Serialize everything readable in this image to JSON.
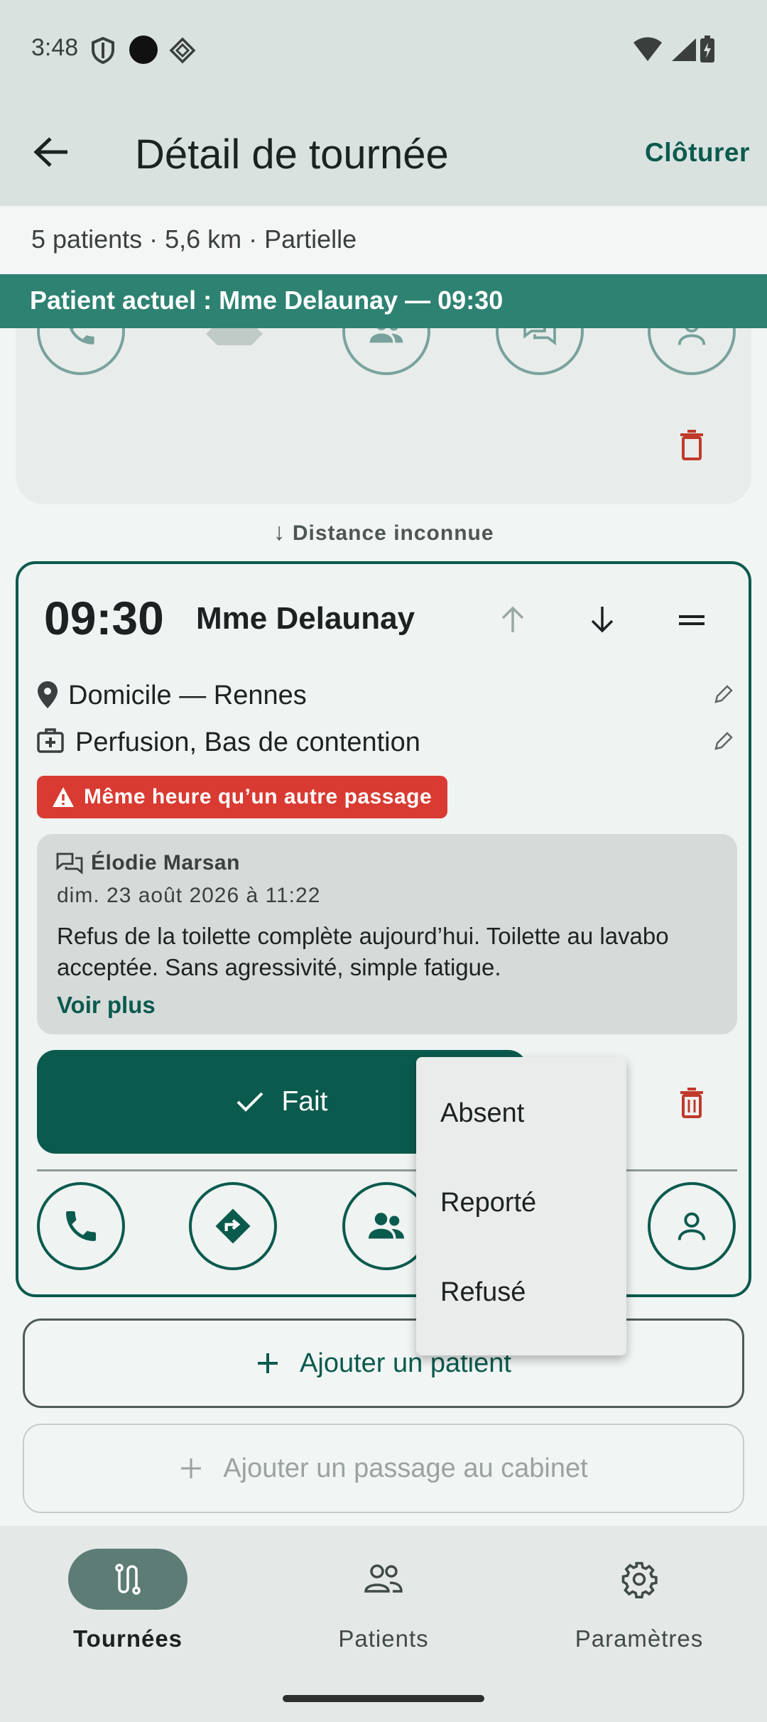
{
  "status_bar": {
    "time": "3:48"
  },
  "app_bar": {
    "title": "Détail de tournée",
    "action_label": "Clôturer"
  },
  "summary": {
    "text": "5 patients · 5,6 km · Partielle"
  },
  "current_patient": {
    "text": "Patient actuel : Mme Delaunay — 09:30"
  },
  "distance": {
    "text": "Distance inconnue"
  },
  "visit": {
    "time": "09:30",
    "name": "Mme Delaunay",
    "place": "Domicile — Rennes",
    "care": "Perfusion, Bas de contention",
    "warning": "Même heure qu’un autre passage",
    "note": {
      "author": "Élodie Marsan",
      "date": "dim. 23 août 2026 à 11:22",
      "body": "Refus de la toilette complète aujourd’hui. Toilette au lavabo acceptée. Sans agressivité, simple fatigue.",
      "see_more": "Voir plus"
    },
    "done_label": "Fait"
  },
  "status_menu": {
    "items": [
      "Absent",
      "Reporté",
      "Refusé"
    ]
  },
  "actions": {
    "add_patient": "Ajouter un patient",
    "add_cabinet": "Ajouter un passage au cabinet"
  },
  "nav": {
    "items": [
      {
        "label": "Tournées",
        "icon": "route-icon",
        "active": true
      },
      {
        "label": "Patients",
        "icon": "people-icon",
        "active": false
      },
      {
        "label": "Paramètres",
        "icon": "gear-icon",
        "active": false
      }
    ]
  },
  "colors": {
    "primary": "#0b5a4e",
    "banner": "#2e8272",
    "warning": "#d93a32",
    "delete": "#c0392b"
  }
}
